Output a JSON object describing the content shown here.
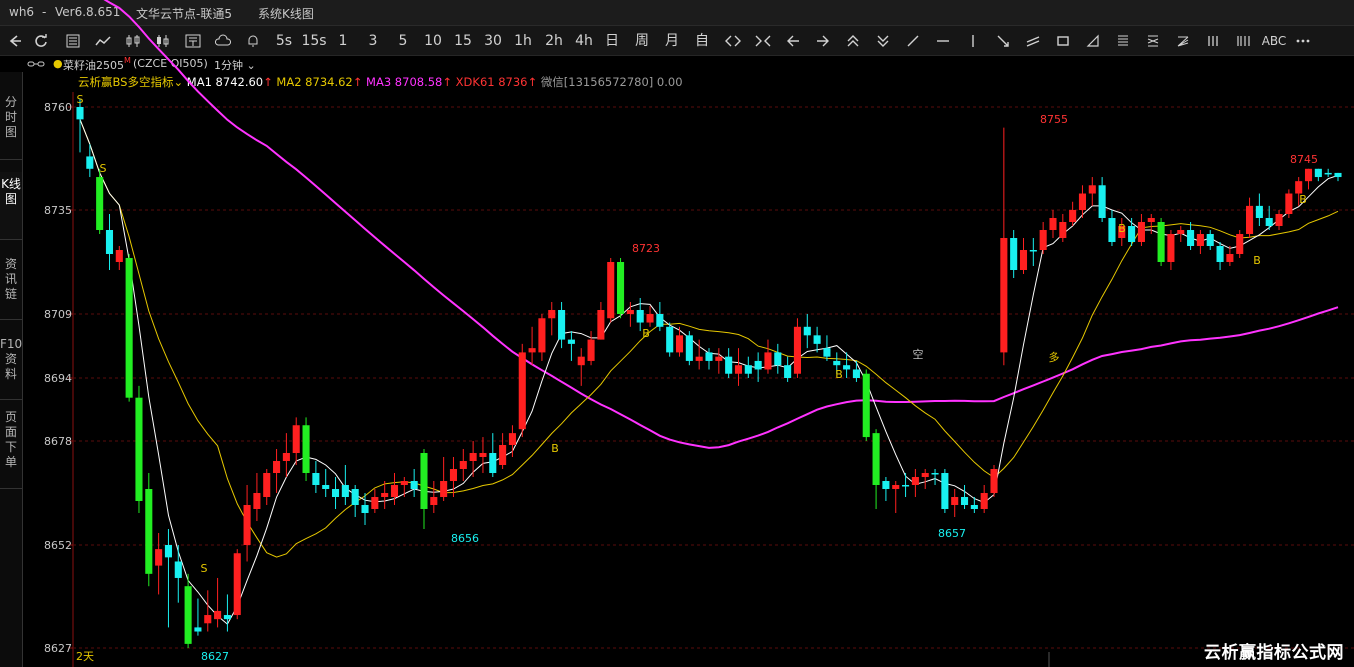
{
  "titlebar": {
    "app": "wh6",
    "sep": "-",
    "version": "Ver6.8.651",
    "server": "文华云节点-联通5",
    "view": "系统K线图"
  },
  "toolbar": {
    "periods": [
      "5s",
      "15s",
      "1",
      "3",
      "5",
      "10",
      "15",
      "30",
      "1h",
      "2h",
      "4h",
      "日",
      "周",
      "月",
      "自"
    ],
    "abc": "ABC"
  },
  "symbol": {
    "name": "菜籽油2505",
    "mark": "M",
    "code": "(CZCE OI505)",
    "period": "1分钟"
  },
  "sidetabs": [
    "分时图",
    "K线图",
    "资讯链",
    "F10资料",
    "页面下单"
  ],
  "indicator": {
    "name": "云析赢BS多空指标",
    "ma1": "MA1 8742.60",
    "ma2": "MA2 8734.62",
    "ma3": "MA3 8708.58",
    "xdk": "XDK61 8736",
    "wechat": "微信[13156572780] 0.00",
    "colors": {
      "ma1": "#ffffff",
      "ma2": "#e6c800",
      "ma3": "#ff33ff",
      "xdk": "#ff3333",
      "up": "#ff2020",
      "down_cyan": "#19f0f0",
      "down_green": "#22ee22"
    }
  },
  "day_label": "2天",
  "watermark": "云析赢指标公式网",
  "chart_data": {
    "type": "candlestick",
    "y_ticks": [
      8760,
      8735,
      8709,
      8694,
      8678,
      8652,
      8627
    ],
    "ylim": [
      8627,
      8760
    ],
    "annotations": {
      "high_1": "8723",
      "high_2": "8755",
      "high_3": "8745",
      "low_1": "8627",
      "low_2": "8656",
      "low_3": "8657",
      "signal_sell": "S",
      "signal_buy": "B",
      "signal_long": "多",
      "signal_short": "空"
    },
    "candles": [
      [
        8760,
        8757,
        8749,
        8762
      ],
      [
        8748,
        8745,
        8743,
        8751
      ],
      [
        8743,
        8730,
        8729,
        8745
      ],
      [
        8730,
        8724,
        8720,
        8734
      ],
      [
        8722,
        8725,
        8720,
        8726
      ],
      [
        8723,
        8689,
        8688,
        8724
      ],
      [
        8689,
        8663,
        8660,
        8692
      ],
      [
        8666,
        8645,
        8642,
        8670
      ],
      [
        8647,
        8651,
        8640,
        8655
      ],
      [
        8652,
        8649,
        8632,
        8656
      ],
      [
        8648,
        8644,
        8638,
        8652
      ],
      [
        8642,
        8628,
        8627,
        8645
      ],
      [
        8632,
        8631,
        8630,
        8639
      ],
      [
        8633,
        8635,
        8631,
        8641
      ],
      [
        8634,
        8636,
        8632,
        8644
      ],
      [
        8635,
        8634,
        8631,
        8640
      ],
      [
        8635,
        8650,
        8634,
        8651
      ],
      [
        8652,
        8662,
        8648,
        8667
      ],
      [
        8661,
        8665,
        8658,
        8670
      ],
      [
        8664,
        8670,
        8662,
        8671
      ],
      [
        8670,
        8673,
        8665,
        8676
      ],
      [
        8673,
        8675,
        8669,
        8680
      ],
      [
        8675,
        8682,
        8672,
        8684
      ],
      [
        8682,
        8670,
        8668,
        8684
      ],
      [
        8670,
        8667,
        8665,
        8673
      ],
      [
        8667,
        8666,
        8664,
        8671
      ],
      [
        8666,
        8664,
        8661,
        8669
      ],
      [
        8667,
        8664,
        8662,
        8672
      ],
      [
        8666,
        8662,
        8659,
        8667
      ],
      [
        8662,
        8660,
        8657,
        8665
      ],
      [
        8661,
        8664,
        8660,
        8666
      ],
      [
        8664,
        8665,
        8661,
        8668
      ],
      [
        8664,
        8667,
        8662,
        8670
      ],
      [
        8667,
        8668,
        8664,
        8669
      ],
      [
        8668,
        8666,
        8664,
        8671
      ],
      [
        8675,
        8661,
        8656,
        8676
      ],
      [
        8662,
        8664,
        8660,
        8668
      ],
      [
        8664,
        8668,
        8663,
        8674
      ],
      [
        8668,
        8671,
        8664,
        8674
      ],
      [
        8671,
        8673,
        8668,
        8676
      ],
      [
        8673,
        8675,
        8669,
        8678
      ],
      [
        8674,
        8675,
        8670,
        8679
      ],
      [
        8675,
        8670,
        8669,
        8680
      ],
      [
        8672,
        8677,
        8671,
        8680
      ],
      [
        8677,
        8680,
        8674,
        8682
      ],
      [
        8681,
        8700,
        8679,
        8702
      ],
      [
        8700,
        8701,
        8697,
        8706
      ],
      [
        8700,
        8708,
        8698,
        8709
      ],
      [
        8708,
        8710,
        8704,
        8712
      ],
      [
        8710,
        8703,
        8701,
        8712
      ],
      [
        8703,
        8702,
        8698,
        8705
      ],
      [
        8697,
        8699,
        8692,
        8701
      ],
      [
        8698,
        8703,
        8697,
        8705
      ],
      [
        8703,
        8710,
        8703,
        8712
      ],
      [
        8708,
        8722,
        8707,
        8723
      ],
      [
        8722,
        8709,
        8708,
        8723
      ],
      [
        8709,
        8710,
        8706,
        8712
      ],
      [
        8710,
        8707,
        8705,
        8713
      ],
      [
        8707,
        8709,
        8706,
        8711
      ],
      [
        8709,
        8706,
        8705,
        8712
      ],
      [
        8706,
        8700,
        8699,
        8707
      ],
      [
        8700,
        8704,
        8699,
        8706
      ],
      [
        8704,
        8698,
        8697,
        8705
      ],
      [
        8698,
        8699,
        8696,
        8703
      ],
      [
        8700,
        8698,
        8696,
        8701
      ],
      [
        8698,
        8699,
        8695,
        8701
      ],
      [
        8699,
        8695,
        8694,
        8701
      ],
      [
        8695,
        8697,
        8692,
        8701
      ],
      [
        8697,
        8695,
        8694,
        8699
      ],
      [
        8698,
        8696,
        8693,
        8700
      ],
      [
        8696,
        8700,
        8695,
        8703
      ],
      [
        8700,
        8697,
        8695,
        8702
      ],
      [
        8697,
        8694,
        8693,
        8699
      ],
      [
        8695,
        8706,
        8694,
        8708
      ],
      [
        8706,
        8704,
        8701,
        8709
      ],
      [
        8704,
        8702,
        8700,
        8706
      ],
      [
        8701,
        8699,
        8698,
        8704
      ],
      [
        8698,
        8697,
        8695,
        8700
      ],
      [
        8697,
        8696,
        8694,
        8700
      ],
      [
        8696,
        8694,
        8693,
        8698
      ],
      [
        8695,
        8679,
        8678,
        8696
      ],
      [
        8680,
        8667,
        8661,
        8681
      ],
      [
        8668,
        8666,
        8663,
        8669
      ],
      [
        8666,
        8667,
        8660,
        8668
      ],
      [
        8667,
        8667,
        8664,
        8670
      ],
      [
        8667,
        8669,
        8664,
        8671
      ],
      [
        8669,
        8670,
        8666,
        8671
      ],
      [
        8670,
        8670,
        8667,
        8671
      ],
      [
        8670,
        8661,
        8660,
        8671
      ],
      [
        8662,
        8664,
        8659,
        8666
      ],
      [
        8664,
        8662,
        8661,
        8667
      ],
      [
        8662,
        8661,
        8660,
        8664
      ],
      [
        8661,
        8665,
        8660,
        8667
      ],
      [
        8665,
        8671,
        8664,
        8672
      ],
      [
        8700,
        8728,
        8697,
        8755
      ],
      [
        8728,
        8720,
        8718,
        8730
      ],
      [
        8720,
        8725,
        8719,
        8728
      ],
      [
        8725,
        8725,
        8721,
        8728
      ],
      [
        8725,
        8730,
        8724,
        8732
      ],
      [
        8730,
        8733,
        8728,
        8735
      ],
      [
        8728,
        8732,
        8727,
        8734
      ],
      [
        8732,
        8735,
        8731,
        8737
      ],
      [
        8735,
        8739,
        8733,
        8741
      ],
      [
        8739,
        8741,
        8736,
        8743
      ],
      [
        8741,
        8733,
        8732,
        8743
      ],
      [
        8733,
        8727,
        8726,
        8735
      ],
      [
        8728,
        8731,
        8726,
        8733
      ],
      [
        8731,
        8727,
        8726,
        8733
      ],
      [
        8727,
        8732,
        8726,
        8734
      ],
      [
        8732,
        8733,
        8729,
        8734
      ],
      [
        8732,
        8722,
        8721,
        8733
      ],
      [
        8722,
        8729,
        8720,
        8730
      ],
      [
        8729,
        8730,
        8727,
        8731
      ],
      [
        8730,
        8726,
        8725,
        8732
      ],
      [
        8726,
        8729,
        8724,
        8730
      ],
      [
        8729,
        8726,
        8725,
        8730
      ],
      [
        8726,
        8722,
        8720,
        8727
      ],
      [
        8722,
        8724,
        8721,
        8726
      ],
      [
        8724,
        8729,
        8723,
        8730
      ],
      [
        8729,
        8736,
        8728,
        8738
      ],
      [
        8736,
        8733,
        8731,
        8739
      ],
      [
        8733,
        8731,
        8730,
        8736
      ],
      [
        8731,
        8734,
        8730,
        8735
      ],
      [
        8734,
        8739,
        8733,
        8740
      ],
      [
        8739,
        8742,
        8736,
        8743
      ],
      [
        8742,
        8745,
        8740,
        8745
      ],
      [
        8745,
        8743,
        8742,
        8745
      ],
      [
        8744,
        8744,
        8743,
        8745
      ],
      [
        8744,
        8743,
        8742,
        8744
      ]
    ],
    "ma2_path": [
      [
        0,
        8762
      ],
      [
        20,
        8730
      ],
      [
        45,
        8655
      ],
      [
        55,
        8640
      ],
      [
        65,
        8646
      ],
      [
        80,
        8669
      ],
      [
        100,
        8688
      ],
      [
        120,
        8704
      ],
      [
        140,
        8708
      ],
      [
        150,
        8710
      ],
      [
        160,
        8713
      ],
      [
        170,
        8712
      ]
    ],
    "ma3_path": [
      [
        0,
        8760
      ]
    ]
  }
}
